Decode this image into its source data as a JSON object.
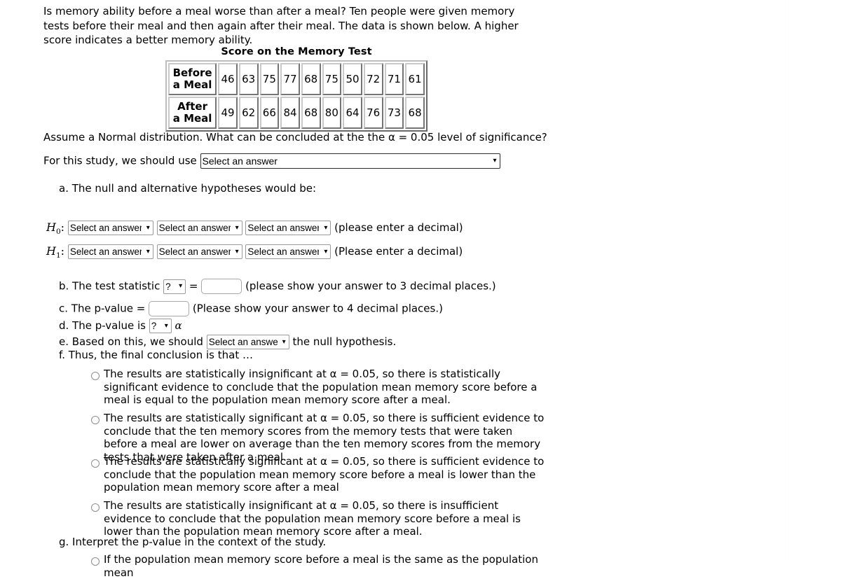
{
  "problem": {
    "intro": "Is memory ability before a meal worse than after a meal?  Ten people were given memory tests before their meal and then again after their meal. The data is shown below. A higher score indicates a better memory ability.",
    "assumption": "Assume a Normal distribution.  What can be concluded at the the α = 0.05 level of significance?",
    "study_prompt": "For this study, we should use"
  },
  "table": {
    "caption": "Score on the Memory Test",
    "rows": [
      {
        "label_line1": "Before",
        "label_line2": "a Meal",
        "values": [
          46,
          63,
          75,
          77,
          68,
          75,
          50,
          72,
          71,
          61
        ]
      },
      {
        "label_line1": "After",
        "label_line2": "a Meal",
        "values": [
          49,
          62,
          66,
          84,
          68,
          80,
          64,
          76,
          73,
          68
        ]
      }
    ]
  },
  "controls": {
    "select_placeholder": "Select an answer",
    "qmark_placeholder": "?",
    "chevron": "❯"
  },
  "parts": {
    "a": {
      "label": "a. The null and alternative hypotheses would be:",
      "h0_symbol": "H",
      "h0_sub": "0",
      "h1_symbol": "H",
      "h1_sub": "1",
      "colon": ":",
      "h0_note": "(please enter a decimal)",
      "h1_note": "(Please enter a decimal)"
    },
    "b": {
      "prefix": "b. The test statistic",
      "equals": "=",
      "note": "(please show your answer to 3 decimal places.)",
      "value": ""
    },
    "c": {
      "prefix": "c. The p-value =",
      "note": "(Please show your answer to 4 decimal places.)",
      "value": ""
    },
    "d": {
      "prefix": "d. The p-value is",
      "alpha": "α"
    },
    "e": {
      "prefix": "e. Based on this, we should",
      "suffix": "the null hypothesis."
    },
    "f": {
      "label": "f. Thus, the final conclusion is that …",
      "options": [
        "The results are statistically insignificant at α = 0.05, so there is statistically significant evidence to conclude that the population mean memory score before a meal is equal to the population mean memory score after a meal.",
        "The results are statistically significant at α = 0.05, so there is sufficient evidence to conclude that the ten memory scores from the memory tests that were taken before a meal are lower on average than the ten memory scores from the memory tests that were taken after a meal.",
        "The results are statistically significant at α = 0.05, so there is sufficient evidence to conclude that the population mean memory score before a meal is lower than the population mean memory score after a meal",
        "The results are statistically insignificant at α = 0.05, so there is insufficient evidence to conclude that the population mean memory score before a meal is lower than the population mean memory score after a meal."
      ]
    },
    "g": {
      "label": "g. Interpret the p-value in the context of the study.",
      "options": [
        "If the population mean memory score before a meal is the same as the population mean"
      ]
    }
  }
}
